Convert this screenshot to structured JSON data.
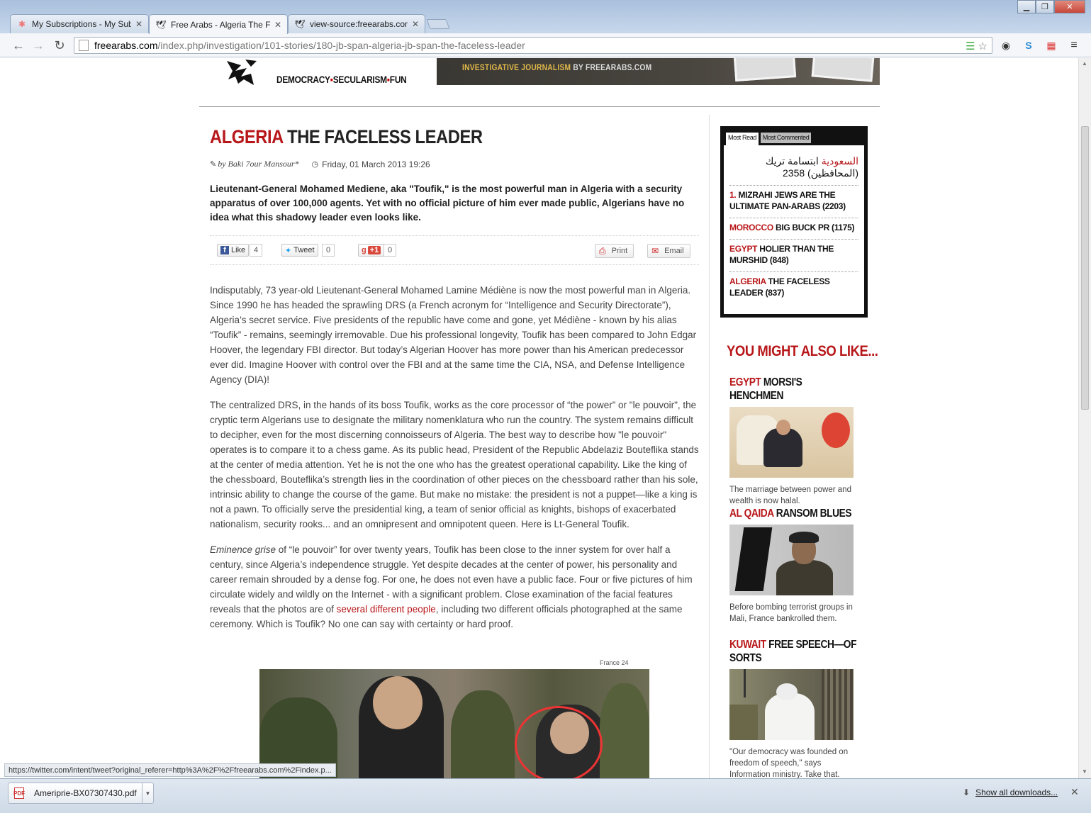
{
  "browser": {
    "tabs": [
      {
        "title": "My Subscriptions - My Sub",
        "active": false,
        "icon": "colorful-pinwheel-icon"
      },
      {
        "title": "Free Arabs - Algeria The Fa",
        "active": true,
        "icon": "free-arabs-bird-icon"
      },
      {
        "title": "view-source:freearabs.con",
        "active": false,
        "icon": "document-icon"
      }
    ],
    "url_host": "freearabs.com",
    "url_path": "/index.php/investigation/101-stories/180-jb-span-algeria-jb-span-the-faceless-leader",
    "status_url": "https://twitter.com/intent/tweet?original_referer=http%3A%2F%2Ffreearabs.com%2Findex.p...",
    "downloads": {
      "file_name": "Ameripriе-BX07307430.pdf",
      "file_badge": "PDF",
      "show_all": "Show all downloads..."
    }
  },
  "site": {
    "tagline_parts": [
      "DEMOCRACY",
      "SECULARISM",
      "FUN"
    ],
    "banner_text": "INVESTIGATIVE JOURNALISM",
    "banner_by": "BY FREEARABS.COM"
  },
  "article": {
    "category": "ALGERIA",
    "title": "THE FACELESS LEADER",
    "author": "by Baki 7our Mansour*",
    "date": "Friday, 01 March 2013 19:26",
    "lede": "Lieutenant-General Mohamed Mediene, aka \"Toufik,\" is the most powerful man in Algeria with a security apparatus of over 100,000 agents. Yet with no official picture of him ever made public, Algerians have no idea what this shadowy leader even looks like.",
    "share": {
      "like_label": "Like",
      "like_count": "4",
      "tweet_label": "Tweet",
      "tweet_count": "0",
      "plus_label": "+1",
      "plus_count": "0",
      "print_label": "Print",
      "email_label": "Email"
    },
    "p1": "Indisputably, 73 year-old Lieutenant-General Mohamed Lamine Médiène is now the most powerful man in Algeria. Since 1990 he has headed the sprawling DRS (a French acronym for “Intelligence and Security Directorate”), Algeria’s secret service. Five presidents of the republic have come and gone, yet Médiène - known by his alias “Toufik” - remains, seemingly irremovable. Due his professional longevity, Toufik has been compared to John Edgar Hoover, the legendary FBI director. But today’s Algerian Hoover has more power than his American predecessor ever did. Imagine Hoover with control over the FBI and at the same time the CIA, NSA, and Defense Intelligence Agency (DIA)!",
    "p2": "The centralized DRS, in the hands of its boss Toufik,  works as the core processor of “the power” or \"le pouvoir\", the cryptic term Algerians use to designate the military nomenklatura who run the country. The system remains difficult to decipher, even for the most discerning connoisseurs of Algeria. The best way to describe how \"le pouvoir\" operates is to compare it to a chess game. As its public head, President of the Republic Abdelaziz Bouteflika stands at the center of media attention. Yet he is not the one who has the greatest operational capability. Like the king of the chessboard, Bouteflika’s strength lies in the coordination of other pieces on the chessboard rather than his sole, intrinsic ability to change the course of the game. But make no mistake: the president is not a puppet—like a king is not a pawn. To officially serve the presidential king, a team of senior official as knights, bishops of exacerbated nationalism, security rooks... and an omnipresent and omnipotent queen. Here is Lt-General Toufik.",
    "p3_em": "Eminence grise",
    "p3_a": " of “le pouvoir” for over twenty years, Toufik has been close to the inner system for over half a century, since Algeria’s independence struggle. Yet despite decades at the center of power, his personality and career remain shrouded by a dense fog. For one, he does not even have a public face. Four or five pictures of him circulate widely and wildly on the Internet - with a significant problem. Close examination of the facial features reveals that the photos are of ",
    "p3_link": "several different people",
    "p3_b": ", including two different officials photographed at the same ceremony. Which is Toufik? No one can say with certainty or hard proof.",
    "photo_credit": "France 24"
  },
  "sidebar": {
    "tab_most_read": "Most Read",
    "tab_most_commented": "Most Commented",
    "most_read": [
      {
        "num": "",
        "red": "السعودية",
        "text": " ابتسامة تريك (المحافظين) 2358",
        "arabic": true
      },
      {
        "num": "1.",
        "red": "",
        "text": "MIZRAHI JEWS ARE THE ULTIMATE PAN-ARABS (2203)",
        "arabic": false
      },
      {
        "num": "",
        "red": "MOROCCO",
        "text": "BIG BUCK PR (1175)",
        "arabic": false
      },
      {
        "num": "",
        "red": "EGYPT",
        "text": "HOLIER THAN THE MURSHID (848)",
        "arabic": false
      },
      {
        "num": "",
        "red": "ALGERIA",
        "text": "THE FACELESS LEADER (837)",
        "arabic": false
      }
    ],
    "you_might_also_like": "YOU MIGHT ALSO LIKE...",
    "related": [
      {
        "red": "EGYPT",
        "title": "MORSI'S HENCHMEN",
        "caption": "The marriage between power and wealth is now halal."
      },
      {
        "red": "AL QAIDA",
        "title": "RANSOM BLUES",
        "caption": "Before bombing terrorist groups in Mali, France bankrolled them."
      },
      {
        "red": "KUWAIT",
        "title": "FREE SPEECH—OF SORTS",
        "caption": "\"Our democracy was founded on freedom of speech,\" says Information ministry. Take that."
      }
    ]
  }
}
